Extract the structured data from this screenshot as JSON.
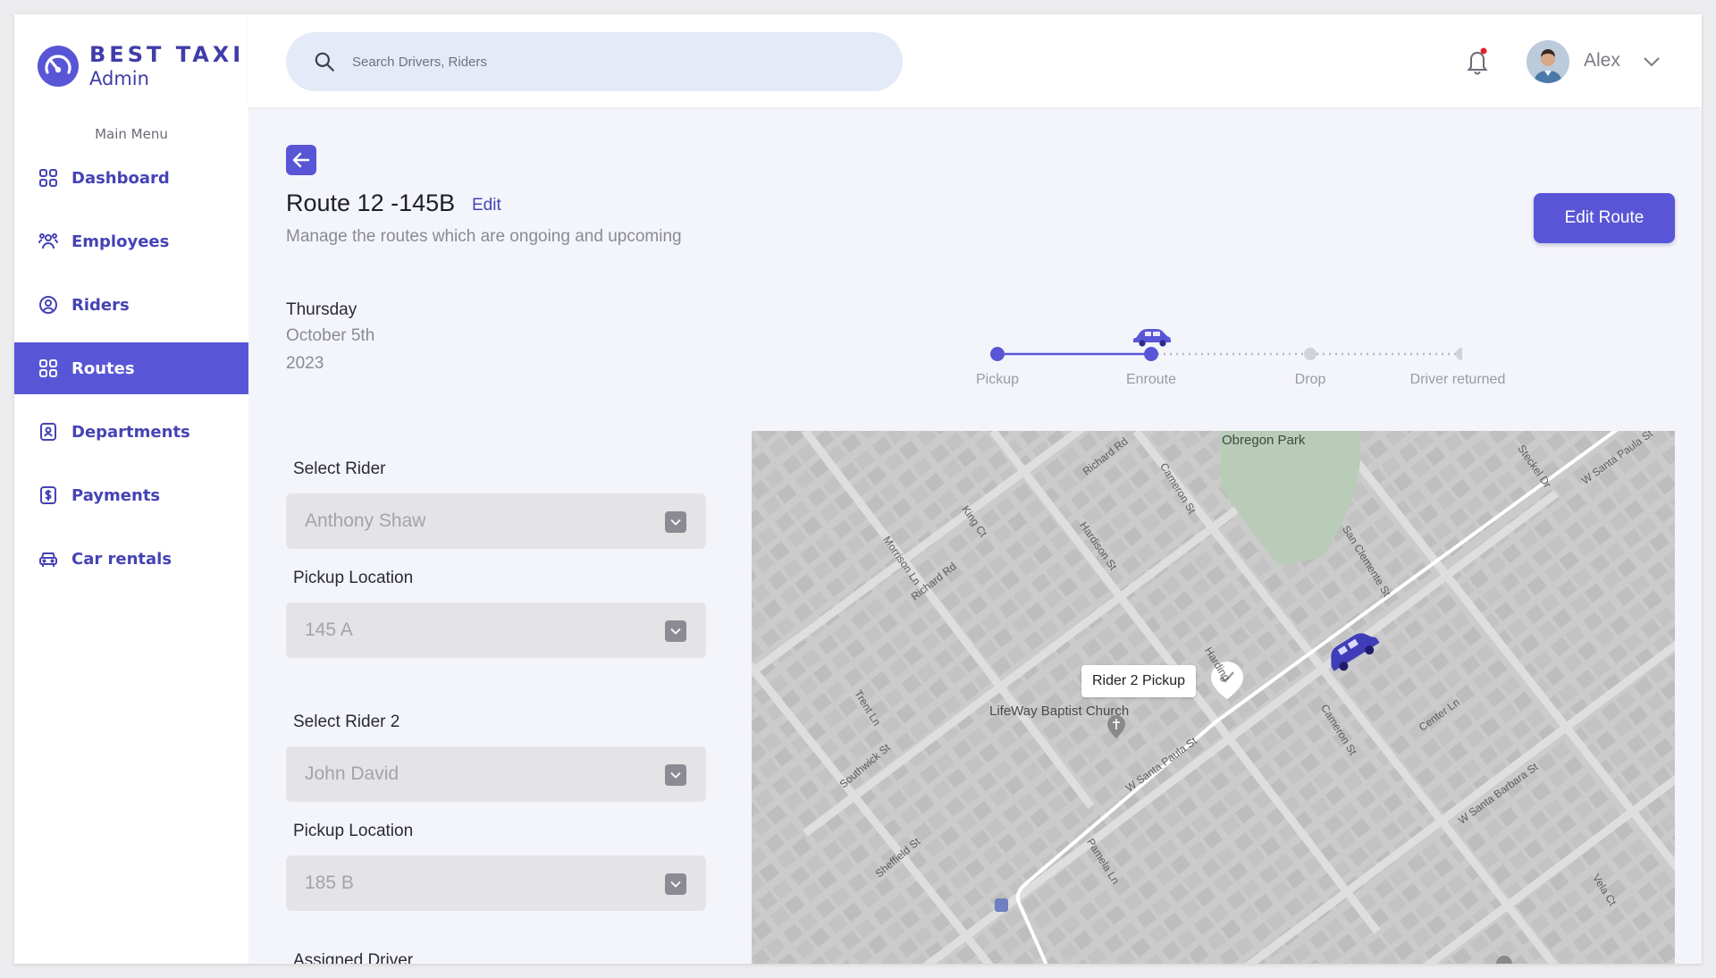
{
  "brand": {
    "name": "BEST TAXI",
    "subtitle": "Admin",
    "color": "#5856d6"
  },
  "sidebar": {
    "menu_label": "Main Menu",
    "items": [
      {
        "label": "Dashboard",
        "icon": "grid-icon",
        "active": false
      },
      {
        "label": "Employees",
        "icon": "people-icon",
        "active": false
      },
      {
        "label": "Riders",
        "icon": "user-circle-icon",
        "active": false
      },
      {
        "label": "Routes",
        "icon": "grid-icon",
        "active": true
      },
      {
        "label": "Departments",
        "icon": "badge-icon",
        "active": false
      },
      {
        "label": "Payments",
        "icon": "dollar-icon",
        "active": false
      },
      {
        "label": "Car rentals",
        "icon": "car-icon",
        "active": false
      }
    ]
  },
  "header": {
    "search_placeholder": "Search Drivers, Riders",
    "user_name": "Alex",
    "notification_dot": "#e02424"
  },
  "route": {
    "title": "Route 12 -145B",
    "edit_label": "Edit",
    "subtitle": "Manage the routes which are ongoing and upcoming",
    "edit_route_button": "Edit Route"
  },
  "date": {
    "day": "Thursday",
    "month_day": "October 5th",
    "year": "2023"
  },
  "tracker": {
    "steps": [
      "Pickup",
      "Enroute",
      "Drop",
      "Driver returned"
    ],
    "current_step": 1
  },
  "form": {
    "rider1_label": "Select Rider",
    "rider1_value": "Anthony Shaw",
    "pickup1_label": "Pickup Location",
    "pickup1_value": "145 A",
    "rider2_label": "Select Rider 2",
    "rider2_value": "John David",
    "pickup2_label": "Pickup Location",
    "pickup2_value": "185 B",
    "driver_label": "Assigned Driver"
  },
  "map": {
    "park_label": "Obregon Park",
    "church_label": "LifeWay Baptist Church",
    "pickup_marker": "Rider 2 Pickup",
    "streets": [
      "Richard Rd",
      "Cameron St",
      "Steckel Dr",
      "W Santa Paula St",
      "King Ct",
      "Hardison St",
      "Morrison Ln",
      "San Clemente St",
      "Center Ln",
      "Trent Ln",
      "Southwick St",
      "Sheffield St",
      "Pamela Ln",
      "W Santa Barbara St",
      "Vela Ct",
      "Harding"
    ]
  }
}
